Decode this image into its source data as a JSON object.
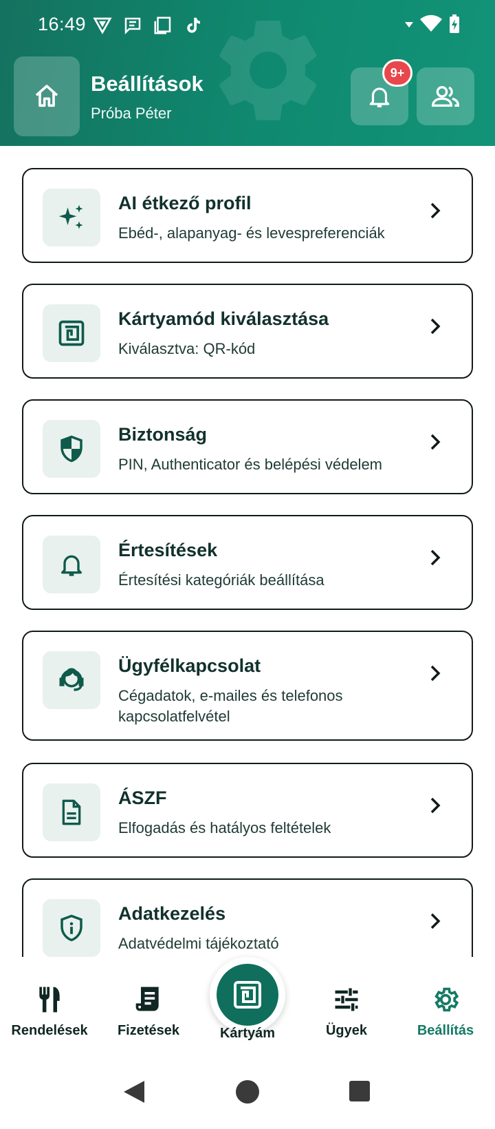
{
  "status_bar": {
    "time": "16:49"
  },
  "header": {
    "title": "Beállítások",
    "subtitle": "Próba Péter",
    "notification_badge": "9+"
  },
  "settings": [
    {
      "title": "AI étkező profil",
      "description": "Ebéd-, alapanyag- és levespreferenciák",
      "icon": "sparkles-icon"
    },
    {
      "title": "Kártyamód kiválasztása",
      "description": "Kiválasztva: QR-kód",
      "icon": "card-mode-icon"
    },
    {
      "title": "Biztonság",
      "description": "PIN, Authenticator és belépési védelem",
      "icon": "shield-icon"
    },
    {
      "title": "Értesítések",
      "description": "Értesítési kategóriák beállítása",
      "icon": "bell-icon"
    },
    {
      "title": "Ügyfélkapcsolat",
      "description": "Cégadatok, e-mailes és telefonos kapcsolatfelvétel",
      "icon": "support-agent-icon"
    },
    {
      "title": "ÁSZF",
      "description": "Elfogadás és hatályos feltételek",
      "icon": "document-icon"
    },
    {
      "title": "Adatkezelés",
      "description": "Adatvédelmi tájékoztató",
      "icon": "privacy-shield-icon"
    }
  ],
  "bottom_nav": {
    "orders": "Rendelések",
    "payments": "Fizetések",
    "my_card": "Kártyám",
    "cases": "Ügyek",
    "settings": "Beállítás"
  },
  "colors": {
    "header_green": "#0f8a70",
    "active_tab": "#137a63",
    "icon_tile": "#e8f1ee",
    "badge_red": "#e8474c"
  }
}
